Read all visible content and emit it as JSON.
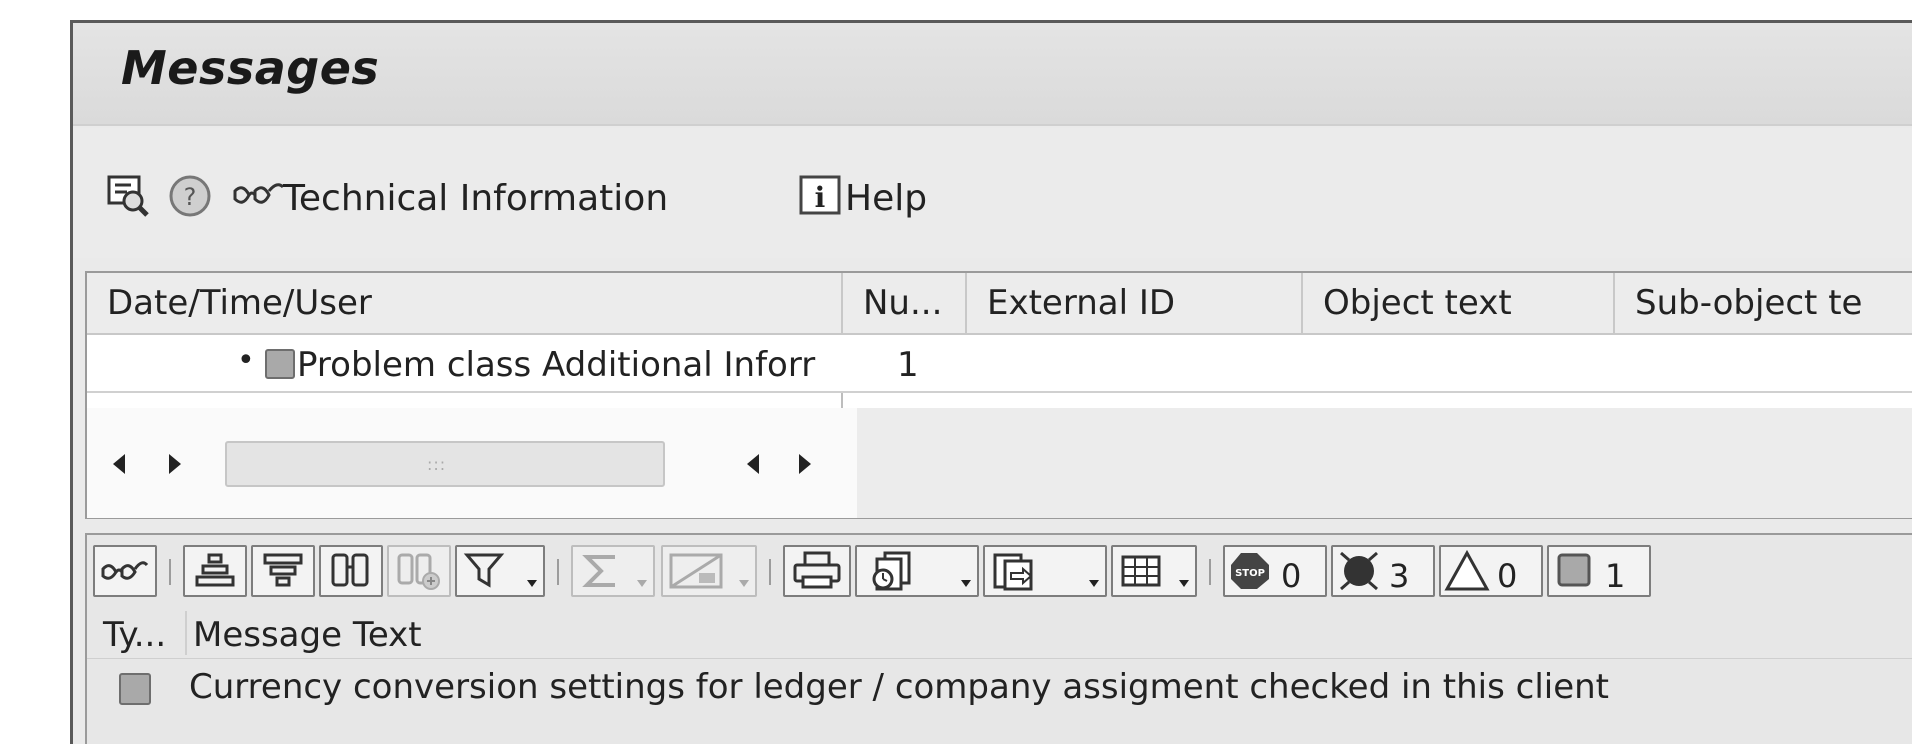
{
  "window": {
    "title": "Messages"
  },
  "toolbar": {
    "technical_information_label": "Technical Information",
    "help_label": "Help",
    "icons": [
      "detail-search-icon",
      "question-icon",
      "glasses-icon",
      "info-icon"
    ]
  },
  "upper_grid": {
    "columns": [
      "Date/Time/User",
      "Nu...",
      "External ID",
      "Object text",
      "Sub-object te"
    ],
    "rows": [
      {
        "bullet": "•",
        "text": "Problem class Additional Inforr",
        "number": "1"
      }
    ],
    "thumb_grip": ":::"
  },
  "alv": {
    "counters": {
      "stop": "0",
      "error": "3",
      "warning": "0",
      "info": "1"
    },
    "stop_text": "STOP",
    "columns": [
      "Ty...",
      "Message Text"
    ],
    "rows": [
      {
        "type_icon": "gray-square-icon",
        "text": "Currency conversion settings for ledger / company assigment checked in this client"
      }
    ]
  }
}
